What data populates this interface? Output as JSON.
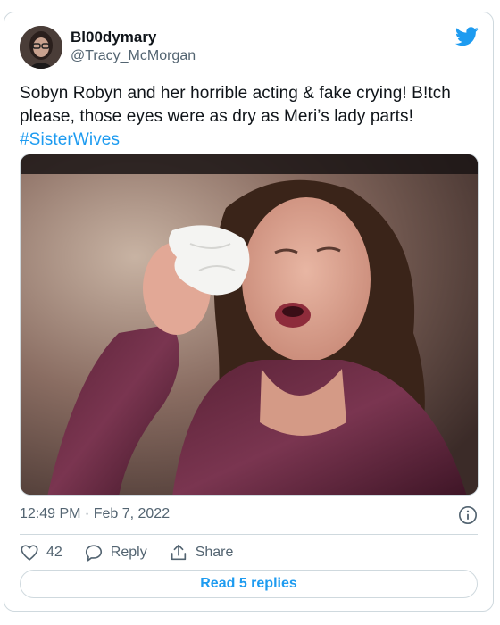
{
  "author": {
    "display_name": "Bl00dymary",
    "handle": "@Tracy_McMorgan"
  },
  "tweet": {
    "text": "Sobyn Robyn and her horrible acting & fake crying! B!tch please, those eyes were as dry as Meri’s lady parts! ",
    "hashtag": "#SisterWives"
  },
  "media": {
    "description": "Photo of a television screen showing a woman with long dark wavy hair in a purple patterned top crying and holding a tissue to her eye"
  },
  "meta": {
    "timestamp": "12:49 PM · Feb 7, 2022"
  },
  "actions": {
    "like_count": "42",
    "reply_label": "Reply",
    "share_label": "Share"
  },
  "footer": {
    "read_replies_label": "Read 5 replies"
  },
  "colors": {
    "accent": "#1d9bf0",
    "secondary_text": "#536471",
    "border": "#cfd9de"
  },
  "icons": [
    "twitter-bird-icon",
    "info-icon",
    "heart-icon",
    "reply-icon",
    "share-icon"
  ]
}
